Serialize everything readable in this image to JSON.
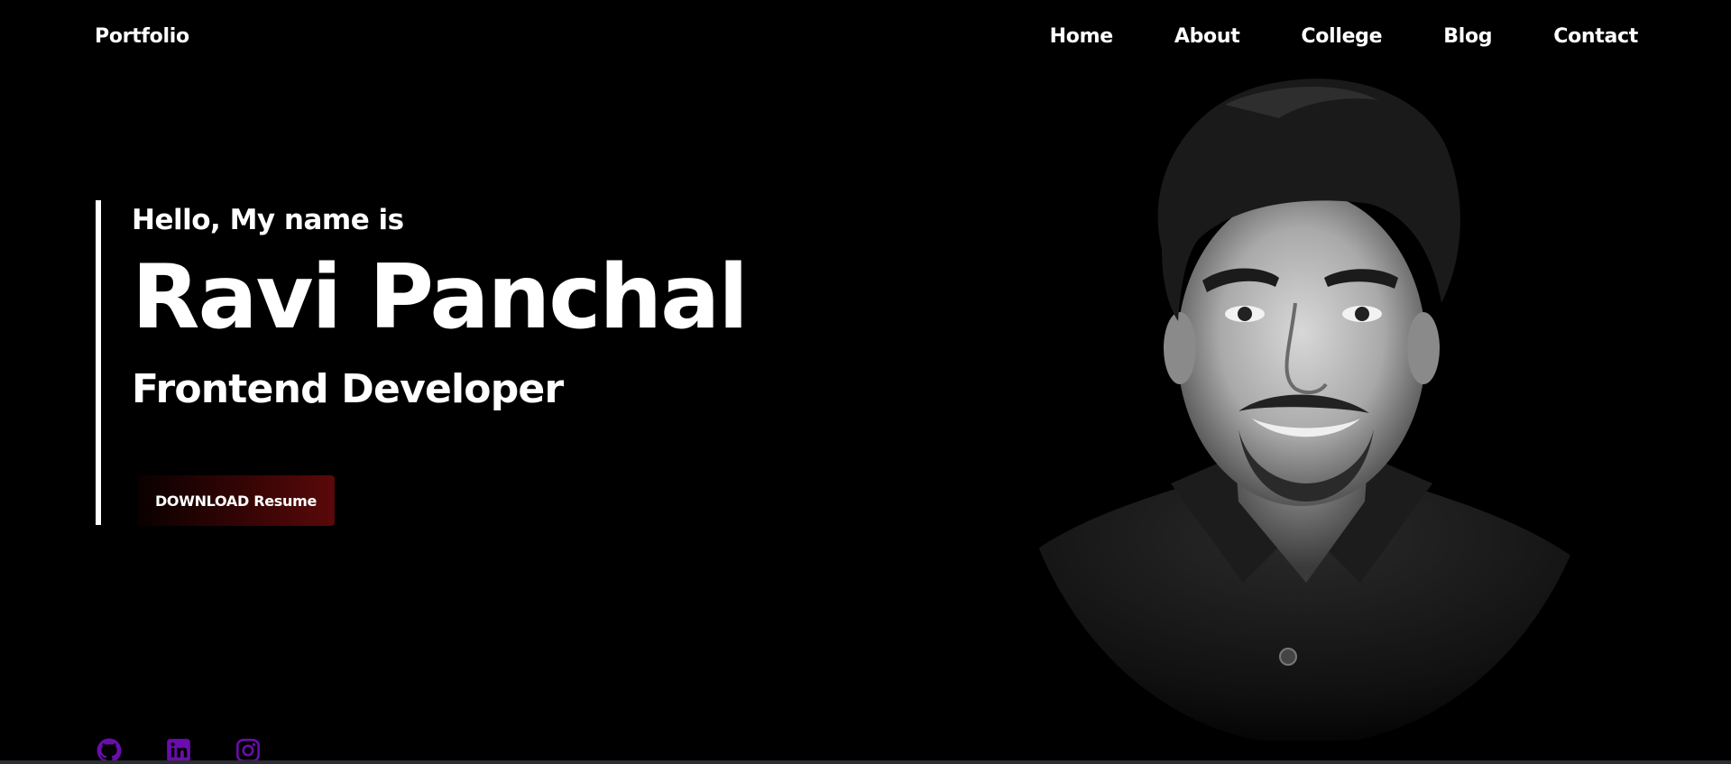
{
  "nav": {
    "brand": "Portfolio",
    "links": [
      "Home",
      "About",
      "College",
      "Blog",
      "Contact"
    ]
  },
  "hero": {
    "greeting": "Hello, My name is",
    "name": "Ravi Panchal",
    "role": "Frontend Developer",
    "cta_label": "DOWNLOAD Resume"
  },
  "social": {
    "icons": [
      "github-icon",
      "linkedin-icon",
      "instagram-icon"
    ],
    "color": "#6a0dad"
  },
  "colors": {
    "background": "#000000",
    "text": "#ffffff",
    "cta_gradient_end": "#5a0909"
  }
}
